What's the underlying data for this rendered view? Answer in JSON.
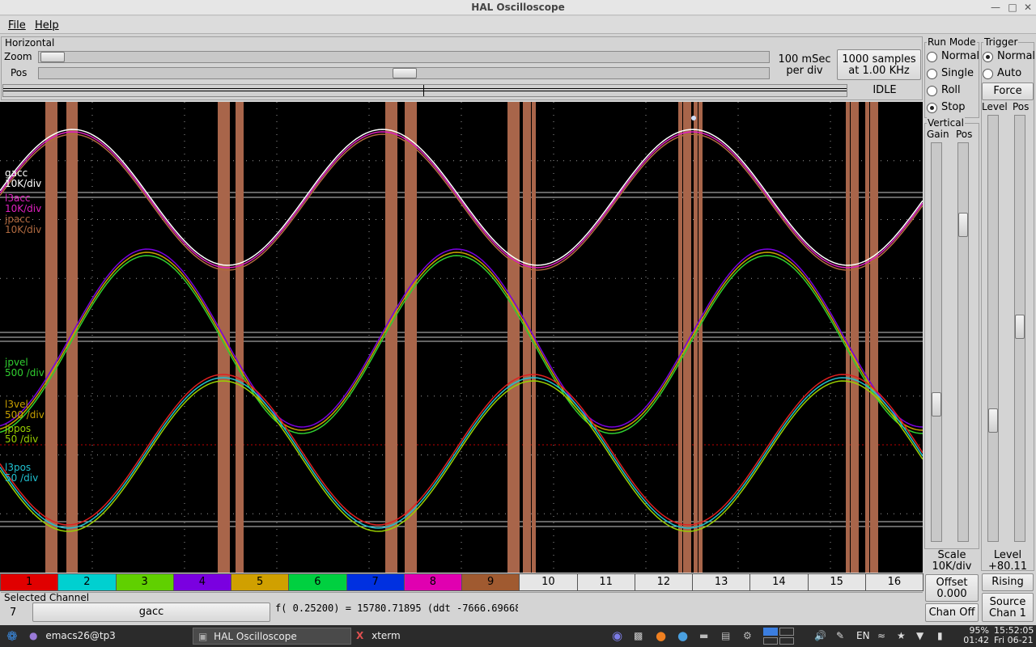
{
  "window": {
    "title": "HAL Oscilloscope"
  },
  "menu": {
    "file": "File",
    "help": "Help"
  },
  "horizontal": {
    "group_label": "Horizontal",
    "zoom_label": "Zoom",
    "pos_label": "Pos",
    "time_per_div": "100 mSec",
    "per_div": "per div",
    "samples": "1000 samples",
    "rate": "at 1.00 KHz",
    "state": "IDLE"
  },
  "run_mode": {
    "label": "Run Mode",
    "options": [
      "Normal",
      "Single",
      "Roll",
      "Stop"
    ],
    "selected": "Stop"
  },
  "trigger": {
    "label": "Trigger",
    "options": [
      "Normal",
      "Auto"
    ],
    "selected": "Normal",
    "force": "Force",
    "level_label": "Level",
    "pos_label": "Pos",
    "level_caption": "Level",
    "level_value": "+80.11",
    "edge": "Rising",
    "source_label": "Source",
    "source_value": "Chan  1"
  },
  "vertical": {
    "label": "Vertical",
    "gain_label": "Gain",
    "pos_label": "Pos",
    "scale_label": "Scale",
    "scale_value": "10K/div",
    "offset_label": "Offset",
    "offset_value": "0.000",
    "chan_off": "Chan Off"
  },
  "channel_labels": [
    {
      "name": "gacc",
      "scale": "10K/div",
      "color": "#ffffff"
    },
    {
      "name": "l3acc",
      "scale": "10K/div",
      "color": "#e020c0"
    },
    {
      "name": "jpacc",
      "scale": "10K/div",
      "color": "#b06a40"
    },
    {
      "name": "jpvel",
      "scale": "500 /div",
      "color": "#30d030"
    },
    {
      "name": "l3vel",
      "scale": "500 /div",
      "color": "#c8a000"
    },
    {
      "name": "jppos",
      "scale": "50 /div",
      "color": "#9ad000"
    },
    {
      "name": "l3pos",
      "scale": "50 /div",
      "color": "#20c0d0"
    }
  ],
  "channels": [
    {
      "label": "1",
      "color": "#e00000"
    },
    {
      "label": "2",
      "color": "#00d0d0"
    },
    {
      "label": "3",
      "color": "#60d000"
    },
    {
      "label": "4",
      "color": "#7a00e0"
    },
    {
      "label": "5",
      "color": "#d0a000"
    },
    {
      "label": "6",
      "color": "#00d040"
    },
    {
      "label": "7",
      "color": "#0030e0"
    },
    {
      "label": "8",
      "color": "#e000b0"
    },
    {
      "label": "9",
      "color": "#a05a30"
    },
    {
      "label": "10",
      "color": "#e6e6e6"
    },
    {
      "label": "11",
      "color": "#e6e6e6"
    },
    {
      "label": "12",
      "color": "#e6e6e6"
    },
    {
      "label": "13",
      "color": "#e6e6e6"
    },
    {
      "label": "14",
      "color": "#e6e6e6"
    },
    {
      "label": "15",
      "color": "#e6e6e6"
    },
    {
      "label": "16",
      "color": "#e6e6e6"
    }
  ],
  "selected_channel": {
    "label": "Selected Channel",
    "number": "7",
    "name": "gacc",
    "readout": "f( 0.25200) =   15780.71895 (ddt -7666.69668"
  },
  "taskbar": {
    "emacs": "emacs26@tp3",
    "scope": "HAL Oscilloscope",
    "xterm": "xterm",
    "lang": "EN",
    "battery": "95%",
    "battery_time": "01:42",
    "time": "15:52:05",
    "date": "Fri 06-21"
  }
}
